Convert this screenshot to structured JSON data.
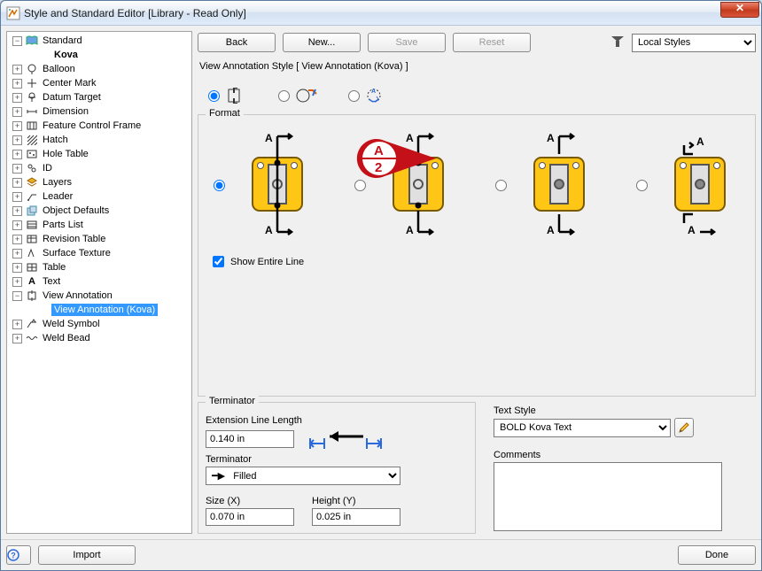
{
  "window": {
    "title": "Style and Standard Editor [Library - Read Only]"
  },
  "toolbar": {
    "back": "Back",
    "new": "New...",
    "save": "Save",
    "reset": "Reset",
    "styles_filter": "Local Styles"
  },
  "desc": "View Annotation Style [ View Annotation (Kova) ]",
  "tree": {
    "root": "Standard",
    "active": "Kova",
    "items": [
      "Balloon",
      "Center Mark",
      "Datum Target",
      "Dimension",
      "Feature Control Frame",
      "Hatch",
      "Hole Table",
      "ID",
      "Layers",
      "Leader",
      "Object Defaults",
      "Parts List",
      "Revision Table",
      "Surface Texture",
      "Table",
      "Text"
    ],
    "view_annotation": "View Annotation",
    "va_child": "View Annotation (Kova)",
    "weld_symbol": "Weld Symbol",
    "weld_bead": "Weld Bead"
  },
  "format": {
    "legend": "Format",
    "show_entire_line": "Show Entire Line",
    "thumb_glyph_a": "A",
    "thumb_glyph_a2": "A",
    "thumb_glyph_a3": "A",
    "thumb_glyph_a4": "A"
  },
  "terminator": {
    "legend": "Terminator",
    "ext_len_label": "Extension Line Length",
    "ext_len_value": "0.140 in",
    "term_label": "Terminator",
    "term_value": "Filled",
    "size_label": "Size (X)",
    "size_value": "0.070 in",
    "height_label": "Height (Y)",
    "height_value": "0.025 in"
  },
  "textstyle": {
    "label": "Text Style",
    "value": "BOLD Kova Text",
    "comments_label": "Comments",
    "comments_value": ""
  },
  "callout": {
    "top": "A",
    "bottom": "2"
  },
  "footer": {
    "import": "Import",
    "done": "Done",
    "help": "?"
  }
}
